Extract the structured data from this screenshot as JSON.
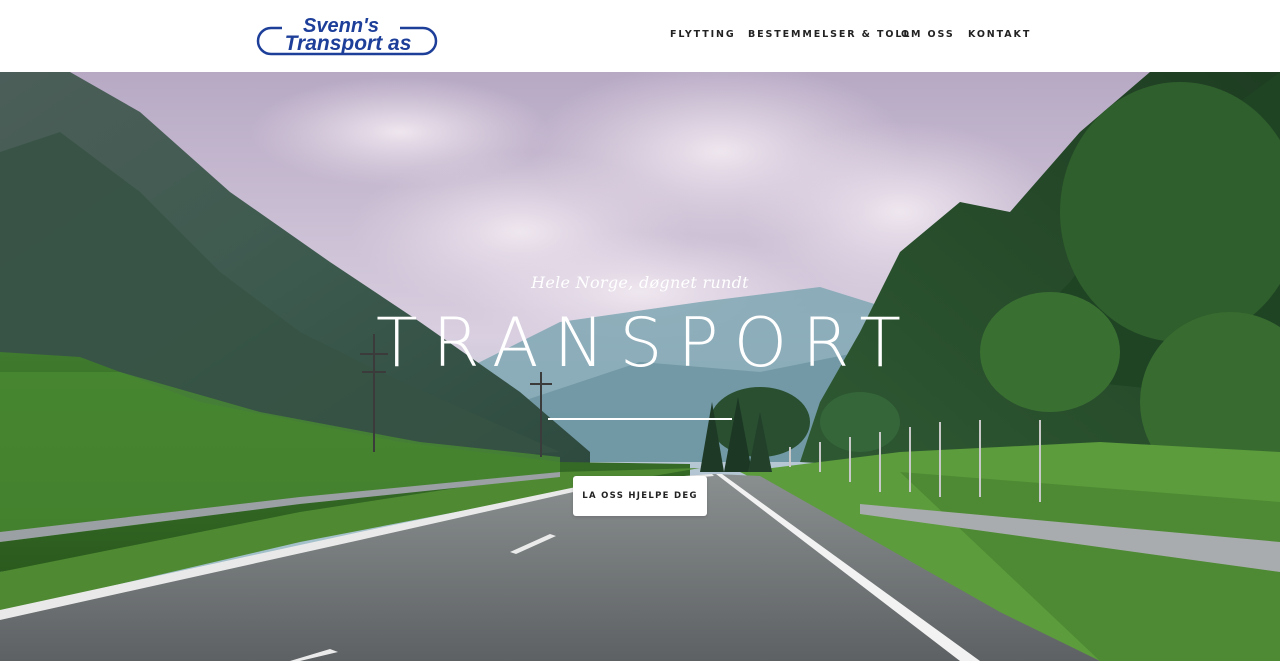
{
  "brand": {
    "logo_line1": "Svenn's",
    "logo_line2": "Transport as",
    "logo_color": "#1d3f9a"
  },
  "nav": {
    "items": [
      {
        "label": "FLYTTING"
      },
      {
        "label": "BESTEMMELSER & TOLL"
      },
      {
        "label": "OM OSS"
      },
      {
        "label": "KONTAKT"
      }
    ]
  },
  "hero": {
    "tagline": "Hele Norge, døgnet rundt",
    "headline": "TRANSPORT",
    "cta_label": "LA OSS HJELPE DEG",
    "background": "mountain-valley-road-photo"
  }
}
